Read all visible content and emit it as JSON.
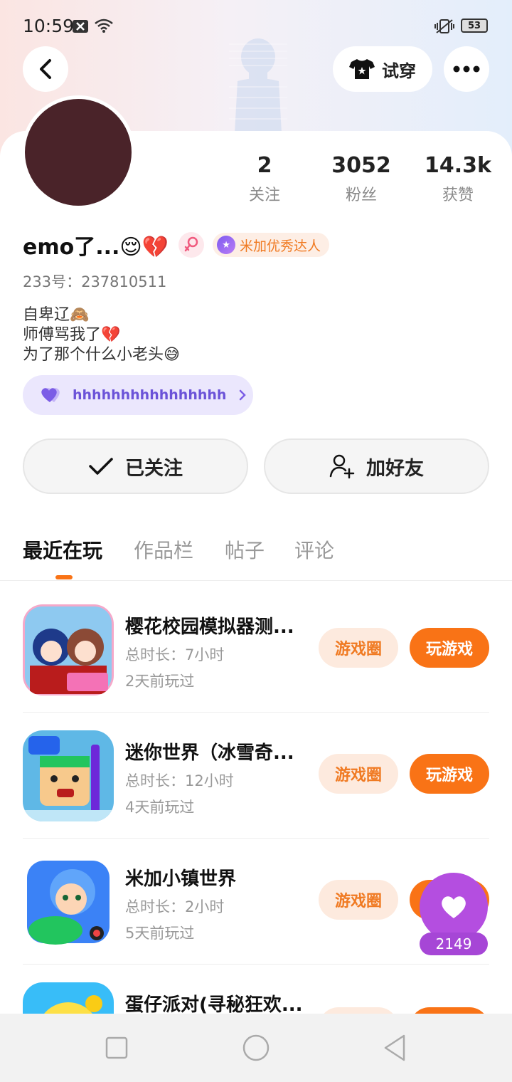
{
  "status_bar": {
    "time": "10:59",
    "battery": "53"
  },
  "header": {
    "tryon_label": "试穿"
  },
  "stats": [
    {
      "value": "2",
      "label": "关注"
    },
    {
      "value": "3052",
      "label": "粉丝"
    },
    {
      "value": "14.3k",
      "label": "获赞"
    }
  ],
  "profile": {
    "name": "emo了...😌💔",
    "level_badge": "米加优秀达人",
    "uid": "233号：237810511",
    "bio": [
      "自卑辽🙈",
      "师傅骂我了💔",
      "为了那个什么小老头😅"
    ],
    "tag": "hhhhhhhhhhhhhhhh"
  },
  "actions": {
    "followed_label": "已关注",
    "add_friend_label": "加好友"
  },
  "tabs": [
    "最近在玩",
    "作品栏",
    "帖子",
    "评论"
  ],
  "games": [
    {
      "title": "樱花校园模拟器测...",
      "duration": "总时长：7小时",
      "last_played": "2天前玩过",
      "circle_label": "游戏圈",
      "play_label": "玩游戏"
    },
    {
      "title": "迷你世界（冰雪奇...",
      "duration": "总时长：12小时",
      "last_played": "4天前玩过",
      "circle_label": "游戏圈",
      "play_label": "玩游戏"
    },
    {
      "title": "米加小镇世界",
      "duration": "总时长：2小时",
      "last_played": "5天前玩过",
      "circle_label": "游戏圈",
      "play_label": "玩游戏"
    },
    {
      "title": "蛋仔派对(寻秘狂欢...",
      "duration": "",
      "last_played": "",
      "circle_label": "",
      "play_label": ""
    }
  ],
  "like": {
    "count": "2149"
  },
  "colors": {
    "accent": "#f97316",
    "like": "#b44ee0",
    "tag_bg": "#ebe7fd"
  }
}
